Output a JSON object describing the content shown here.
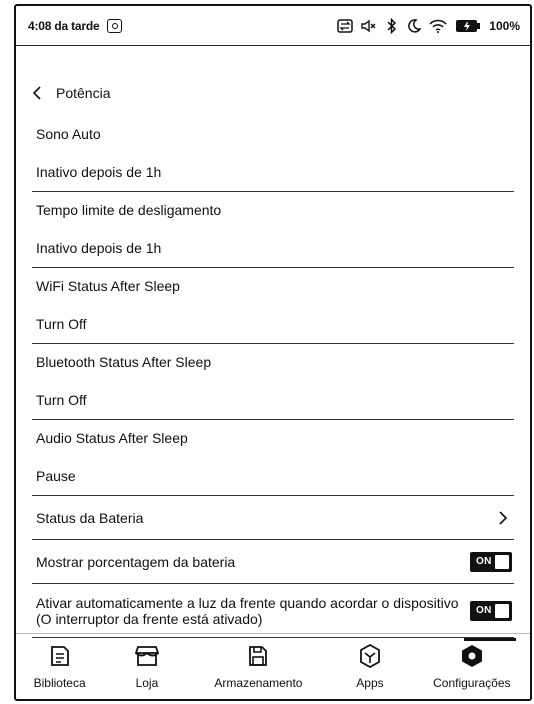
{
  "status_bar": {
    "time": "4:08 da tarde",
    "battery_pct": "100%"
  },
  "header": {
    "title": "Potência"
  },
  "settings": [
    {
      "title": "Sono Auto",
      "value": "Inativo depois de 1h"
    },
    {
      "title": "Tempo limite de desligamento",
      "value": "Inativo depois de 1h"
    },
    {
      "title": "WiFi Status After Sleep",
      "value": "Turn Off"
    },
    {
      "title": "Bluetooth Status After Sleep",
      "value": "Turn Off"
    },
    {
      "title": "Audio Status After Sleep",
      "value": "Pause"
    }
  ],
  "battery_status": {
    "label": "Status da Bateria"
  },
  "show_battery_pct": {
    "label": "Mostrar porcentagem da bateria",
    "toggle": "ON"
  },
  "front_light": {
    "label_line1": "Ativar automaticamente a luz da frente quando acordar o dispositivo",
    "label_line2": "(O interruptor da frente está ativado)",
    "toggle": "ON"
  },
  "nav": [
    {
      "label": "Biblioteca",
      "icon": "library-icon"
    },
    {
      "label": "Loja",
      "icon": "store-icon"
    },
    {
      "label": "Armazenamento",
      "icon": "storage-icon"
    },
    {
      "label": "Apps",
      "icon": "apps-icon"
    },
    {
      "label": "Configurações",
      "icon": "settings-icon"
    }
  ]
}
